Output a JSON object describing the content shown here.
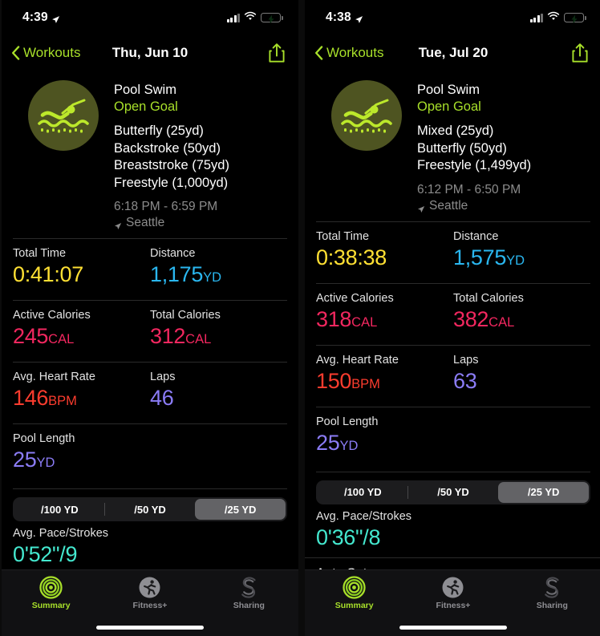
{
  "colors": {
    "accent_green": "#a8e02a",
    "time_yellow": "#ffe033",
    "distance_blue": "#2ab7f0",
    "calories_pink": "#f2275f",
    "heart_red": "#fc3c2e",
    "laps_purple": "#8b7cf6",
    "pace_teal": "#44e8cf",
    "badge_bg": "#4e5421",
    "muted": "#8c8c8c"
  },
  "panels": [
    {
      "status": {
        "time": "4:39",
        "location_icon": "location-arrow-icon",
        "signal_icon": "cellular-bars-icon",
        "wifi_icon": "wifi-icon",
        "battery_icon": "battery-charging-icon"
      },
      "nav": {
        "back_label": "Workouts",
        "back_icon": "chevron-left-icon",
        "title": "Thu, Jun 10",
        "share_icon": "share-icon"
      },
      "hero": {
        "badge_icon": "pool-swim-icon",
        "workout_type": "Pool Swim",
        "goal": "Open Goal",
        "strokes": [
          "Butterfly (25yd)",
          "Backstroke (50yd)",
          "Breaststroke (75yd)",
          "Freestyle (1,000yd)"
        ],
        "time_range": "6:18 PM - 6:59 PM",
        "location": "Seattle",
        "location_icon": "location-arrow-icon"
      },
      "metrics": [
        [
          {
            "label": "Total Time",
            "value": "0:41:07",
            "unit": "",
            "color": "#ffe033"
          },
          {
            "label": "Distance",
            "value": "1,175",
            "unit": "YD",
            "color": "#2ab7f0"
          }
        ],
        [
          {
            "label": "Active Calories",
            "value": "245",
            "unit": "CAL",
            "color": "#f2275f"
          },
          {
            "label": "Total Calories",
            "value": "312",
            "unit": "CAL",
            "color": "#f2275f"
          }
        ],
        [
          {
            "label": "Avg. Heart Rate",
            "value": "146",
            "unit": "BPM",
            "color": "#fc3c2e"
          },
          {
            "label": "Laps",
            "value": "46",
            "unit": "",
            "color": "#8b7cf6"
          }
        ],
        [
          {
            "label": "Pool Length",
            "value": "25",
            "unit": "YD",
            "color": "#8b7cf6"
          }
        ]
      ],
      "segmented": {
        "options": [
          "/100 YD",
          "/50 YD",
          "/25 YD"
        ],
        "selected_index": 2
      },
      "pace": {
        "label": "Avg. Pace/Strokes",
        "value": "0'52\"/9",
        "color": "#44e8cf"
      },
      "auto_sets": null,
      "tabs": [
        {
          "label": "Summary",
          "icon": "activity-rings-icon",
          "active": true
        },
        {
          "label": "Fitness+",
          "icon": "runner-icon",
          "active": false
        },
        {
          "label": "Sharing",
          "icon": "sharing-s-icon",
          "active": false
        }
      ]
    },
    {
      "status": {
        "time": "4:38",
        "location_icon": "location-arrow-icon",
        "signal_icon": "cellular-bars-icon",
        "wifi_icon": "wifi-icon",
        "battery_icon": "battery-charging-icon"
      },
      "nav": {
        "back_label": "Workouts",
        "back_icon": "chevron-left-icon",
        "title": "Tue, Jul 20",
        "share_icon": "share-icon"
      },
      "hero": {
        "badge_icon": "pool-swim-icon",
        "workout_type": "Pool Swim",
        "goal": "Open Goal",
        "strokes": [
          "Mixed (25yd)",
          "Butterfly (50yd)",
          "Freestyle (1,499yd)"
        ],
        "time_range": "6:12 PM - 6:50 PM",
        "location": "Seattle",
        "location_icon": "location-arrow-icon"
      },
      "metrics": [
        [
          {
            "label": "Total Time",
            "value": "0:38:38",
            "unit": "",
            "color": "#ffe033"
          },
          {
            "label": "Distance",
            "value": "1,575",
            "unit": "YD",
            "color": "#2ab7f0"
          }
        ],
        [
          {
            "label": "Active Calories",
            "value": "318",
            "unit": "CAL",
            "color": "#f2275f"
          },
          {
            "label": "Total Calories",
            "value": "382",
            "unit": "CAL",
            "color": "#f2275f"
          }
        ],
        [
          {
            "label": "Avg. Heart Rate",
            "value": "150",
            "unit": "BPM",
            "color": "#fc3c2e"
          },
          {
            "label": "Laps",
            "value": "63",
            "unit": "",
            "color": "#8b7cf6"
          }
        ],
        [
          {
            "label": "Pool Length",
            "value": "25",
            "unit": "YD",
            "color": "#8b7cf6"
          }
        ]
      ],
      "segmented": {
        "options": [
          "/100 YD",
          "/50 YD",
          "/25 YD"
        ],
        "selected_index": 2
      },
      "pace": {
        "label": "Avg. Pace/Strokes",
        "value": "0'36\"/8",
        "color": "#44e8cf"
      },
      "auto_sets": {
        "label": "Auto Sets",
        "chevron_icon": "chevron-down-icon"
      },
      "tabs": [
        {
          "label": "Summary",
          "icon": "activity-rings-icon",
          "active": true
        },
        {
          "label": "Fitness+",
          "icon": "runner-icon",
          "active": false
        },
        {
          "label": "Sharing",
          "icon": "sharing-s-icon",
          "active": false
        }
      ]
    }
  ]
}
